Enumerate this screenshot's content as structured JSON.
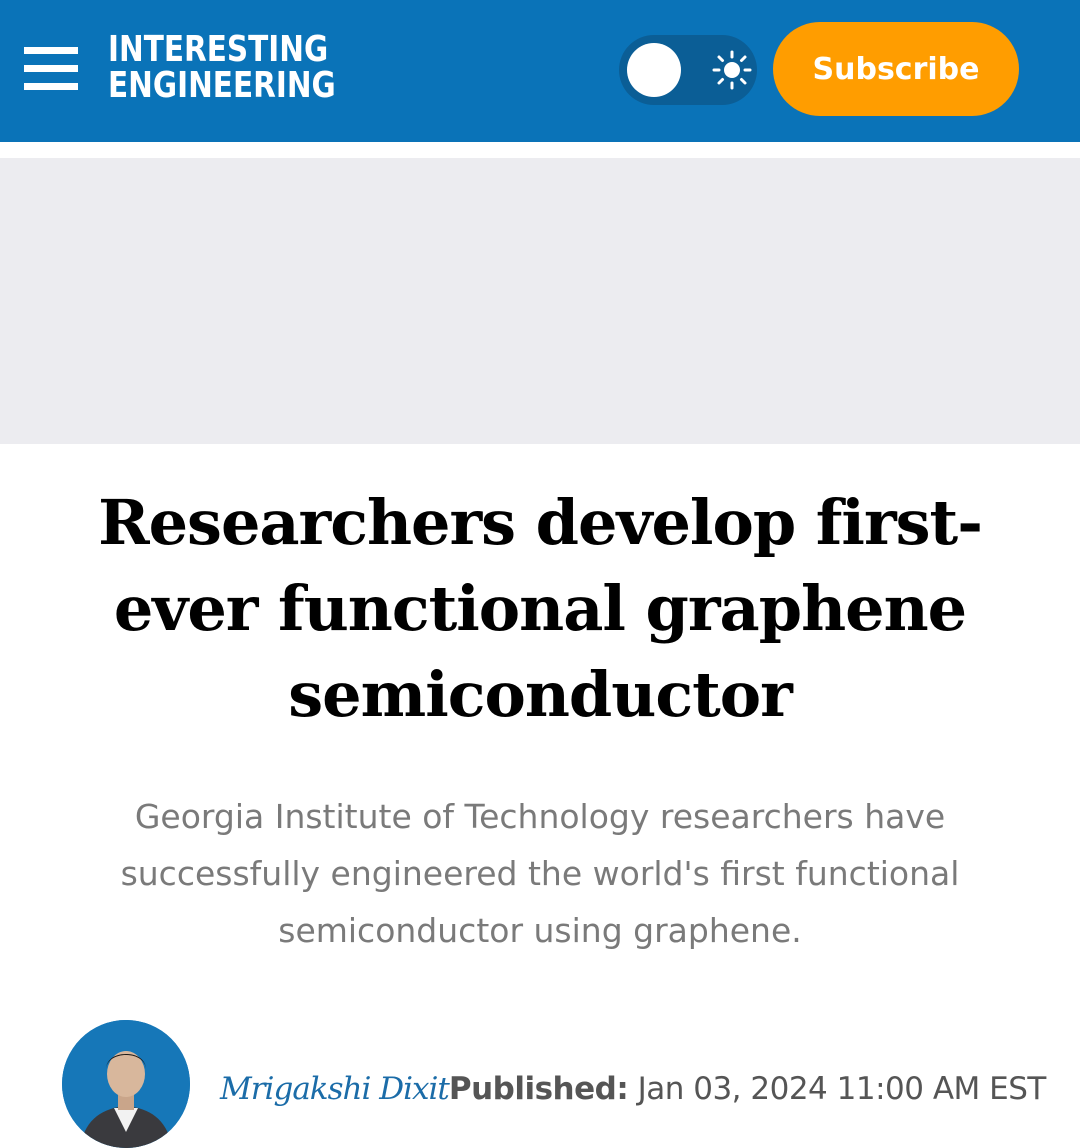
{
  "colors": {
    "header_bg": "#0a73b8",
    "subscribe_bg": "#ff9d00",
    "ad_bg": "#ececf0",
    "author_link": "#1b6ca8"
  },
  "header": {
    "menu_icon": "hamburger-menu-icon",
    "logo_line1": "INTERESTING",
    "logo_line2": "ENGINEERING",
    "theme_toggle_icon": "sun-icon",
    "subscribe_label": "Subscribe"
  },
  "article": {
    "headline": "Researchers develop first-ever functional graphene semiconductor",
    "dek": "Georgia Institute of Technology researchers have successfully engineered the world's first functional semiconductor using graphene.",
    "author": "Mrigakshi Dixit",
    "published_label": "Published:",
    "published_date": " Jan 03, 2024 11:00 AM EST"
  }
}
